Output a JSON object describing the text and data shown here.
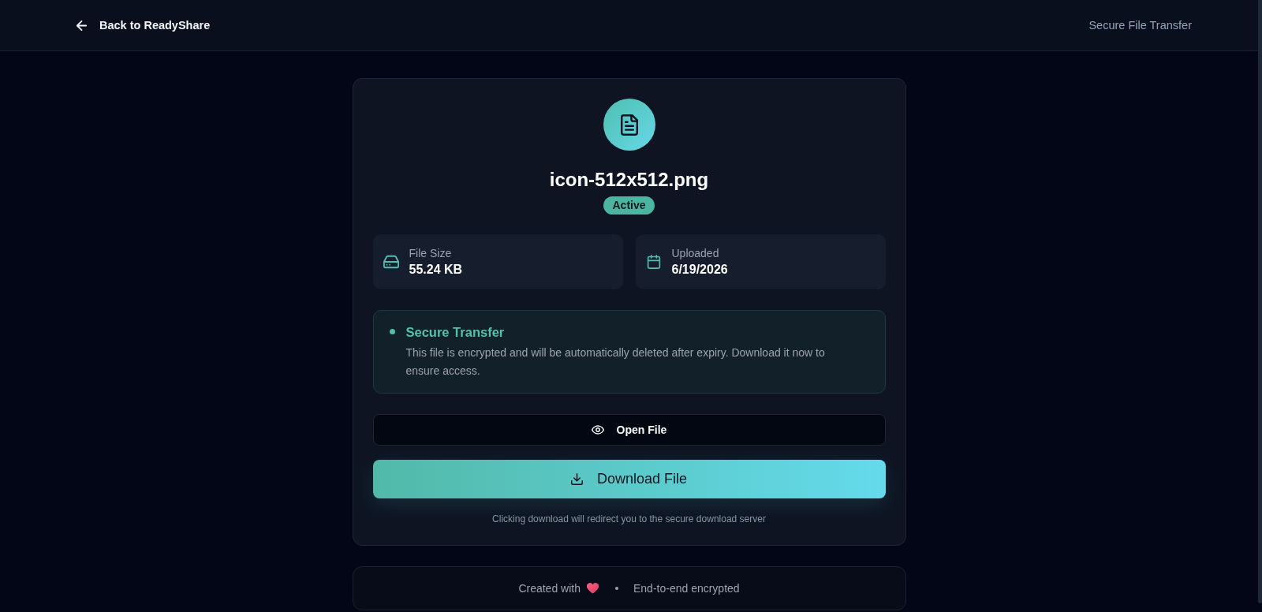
{
  "header": {
    "back_link": "Back to ReadyShare",
    "tagline": "Secure File Transfer"
  },
  "file": {
    "name": "icon-512x512.png",
    "status_badge": "Active"
  },
  "details": [
    {
      "kind": "size",
      "label": "File Size",
      "value": "55.24 KB"
    },
    {
      "kind": "date",
      "label": "Uploaded",
      "value": "6/19/2026"
    }
  ],
  "notice": {
    "title": "Secure Transfer",
    "text": "This file is encrypted and will be automatically deleted after expiry. Download it now to ensure access."
  },
  "buttons": [
    {
      "kind": "open",
      "label": "Open File"
    },
    {
      "kind": "download",
      "label": "Download File"
    }
  ],
  "download_note": "Clicking download will redirect you to the secure download server",
  "footer": {
    "credit": "Created with",
    "note": "End-to-end encrypted"
  }
}
